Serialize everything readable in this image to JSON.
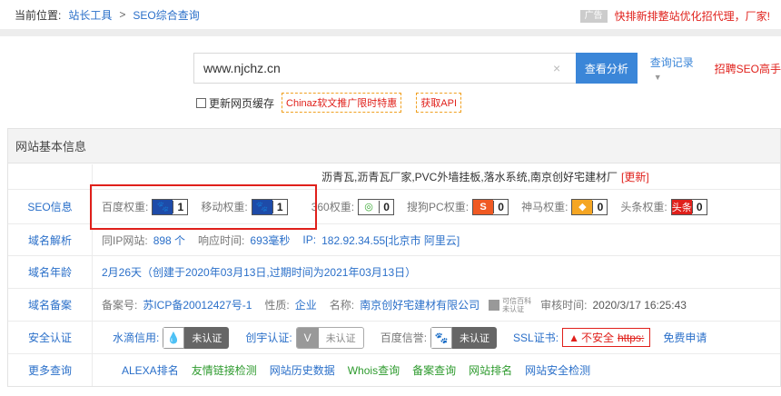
{
  "breadcrumb": {
    "prefix": "当前位置:",
    "level1": "站长工具",
    "sep": ">",
    "level2": "SEO综合查询"
  },
  "ad": {
    "tag": "广告",
    "text": "快排新排整站优化招代理，厂家!"
  },
  "search": {
    "value": "www.njchz.cn",
    "clear_icon": "×",
    "button": "查看分析",
    "history": "查询记录",
    "history_caret": "▼",
    "recruit": "招聘SEO高手"
  },
  "options": {
    "refresh_cache": "更新网页缓存",
    "promo": "Chinaz软文推广限时特惠",
    "api": "获取API"
  },
  "panel": {
    "title": "网站基本信息",
    "keywords": "沥青瓦,沥青瓦厂家,PVC外墙挂板,落水系统,南京创好宅建材厂",
    "update": "[更新]",
    "seo": {
      "label": "SEO信息",
      "baidu": {
        "label": "百度权重:",
        "value": "1",
        "icon": "paw-icon"
      },
      "mobile": {
        "label": "移动权重:",
        "value": "1",
        "icon": "paw-icon"
      },
      "so360": {
        "label": "360权重:",
        "value": "0",
        "icon": "360-icon"
      },
      "sogou": {
        "label": "搜狗PC权重:",
        "value": "0",
        "icon": "sogou-icon",
        "glyph": "S"
      },
      "shenma": {
        "label": "神马权重:",
        "value": "0",
        "icon": "shenma-icon"
      },
      "toutiao": {
        "label": "头条权重:",
        "value": "0",
        "icon": "toutiao-icon",
        "glyph": "头条"
      }
    },
    "dns": {
      "label": "域名解析",
      "same_ip_label": "同IP网站:",
      "same_ip_value": "898 个",
      "response_label": "响应时间:",
      "response_value": "693毫秒",
      "ip_label": "IP:",
      "ip_value": "182.92.34.55[北京市 阿里云]"
    },
    "age": {
      "label": "域名年龄",
      "value": "2月26天（创建于2020年03月13日,过期时间为2021年03月13日）"
    },
    "record": {
      "label": "域名备案",
      "no_label": "备案号:",
      "no_value": "苏ICP备20012427号-1",
      "nature_label": "性质:",
      "nature_value": "企业",
      "name_label": "名称:",
      "name_value": "南京创好宅建材有限公司",
      "badge_text": "可信百科",
      "badge_sub": "未认证",
      "time_label": "审核时间:",
      "time_value": "2020/3/17 16:25:43"
    },
    "security": {
      "label": "安全认证",
      "shuidi_label": "水滴信用:",
      "shuidi_value": "未认证",
      "chuangyu_label": "创宇认证:",
      "chuangyu_value": "未认证",
      "baidu_label": "百度信誉:",
      "baidu_value": "未认证",
      "ssl_label": "SSL证书:",
      "ssl_value": "不安全",
      "ssl_strike": "https:",
      "free_apply": "免费申请"
    },
    "more": {
      "label": "更多查询",
      "links": [
        "ALEXA排名",
        "友情链接检测",
        "网站历史数据",
        "Whois查询",
        "备案查询",
        "网站排名",
        "网站安全检测"
      ]
    }
  }
}
